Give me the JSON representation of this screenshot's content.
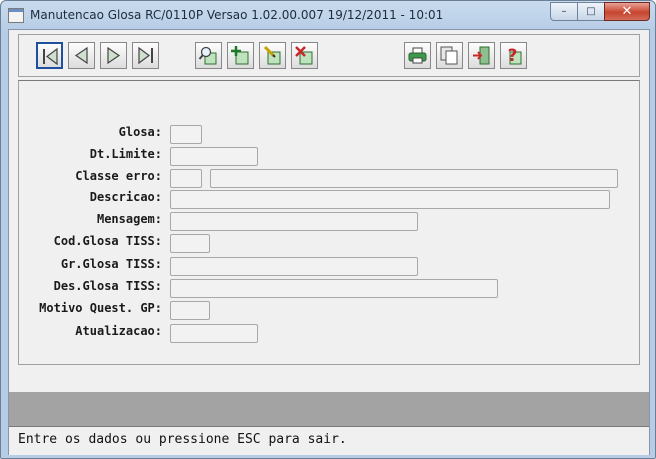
{
  "window": {
    "title": "Manutencao  Glosa RC/0110P Versao 1.02.00.007 19/12/2011 - 10:01",
    "minimize_glyph": "–",
    "maximize_glyph": "□",
    "close_glyph": "✕"
  },
  "toolbar": {
    "buttons": [
      {
        "name": "first-record",
        "icon": "first-record-icon"
      },
      {
        "name": "previous-record",
        "icon": "previous-record-icon"
      },
      {
        "name": "next-record",
        "icon": "next-record-icon"
      },
      {
        "name": "last-record",
        "icon": "last-record-icon"
      },
      {
        "name": "search",
        "icon": "magnifier-icon"
      },
      {
        "name": "add",
        "icon": "add-record-icon"
      },
      {
        "name": "edit",
        "icon": "edit-record-icon"
      },
      {
        "name": "delete",
        "icon": "delete-record-icon"
      },
      {
        "name": "print",
        "icon": "printer-icon"
      },
      {
        "name": "copy",
        "icon": "copy-icon"
      },
      {
        "name": "exit",
        "icon": "exit-door-icon"
      },
      {
        "name": "help",
        "icon": "help-icon"
      }
    ]
  },
  "form": {
    "glosa": {
      "label": "Glosa:",
      "value": ""
    },
    "dt_limite": {
      "label": "Dt.Limite:",
      "value": ""
    },
    "classe_erro": {
      "label": "Classe erro:",
      "code": "",
      "description": ""
    },
    "descricao": {
      "label": "Descricao:",
      "value": ""
    },
    "mensagem": {
      "label": "Mensagem:",
      "value": ""
    },
    "cod_glosa_tiss": {
      "label": "Cod.Glosa TISS:",
      "value": ""
    },
    "gr_glosa_tiss": {
      "label": "Gr.Glosa TISS:",
      "value": ""
    },
    "des_glosa_tiss": {
      "label": "Des.Glosa TISS:",
      "value": ""
    },
    "motivo_quest_gp": {
      "label": "Motivo Quest. GP:",
      "value": ""
    },
    "atualizacao": {
      "label": "Atualizacao:",
      "value": ""
    }
  },
  "status": {
    "message": "Entre os dados ou pressione ESC para sair."
  }
}
